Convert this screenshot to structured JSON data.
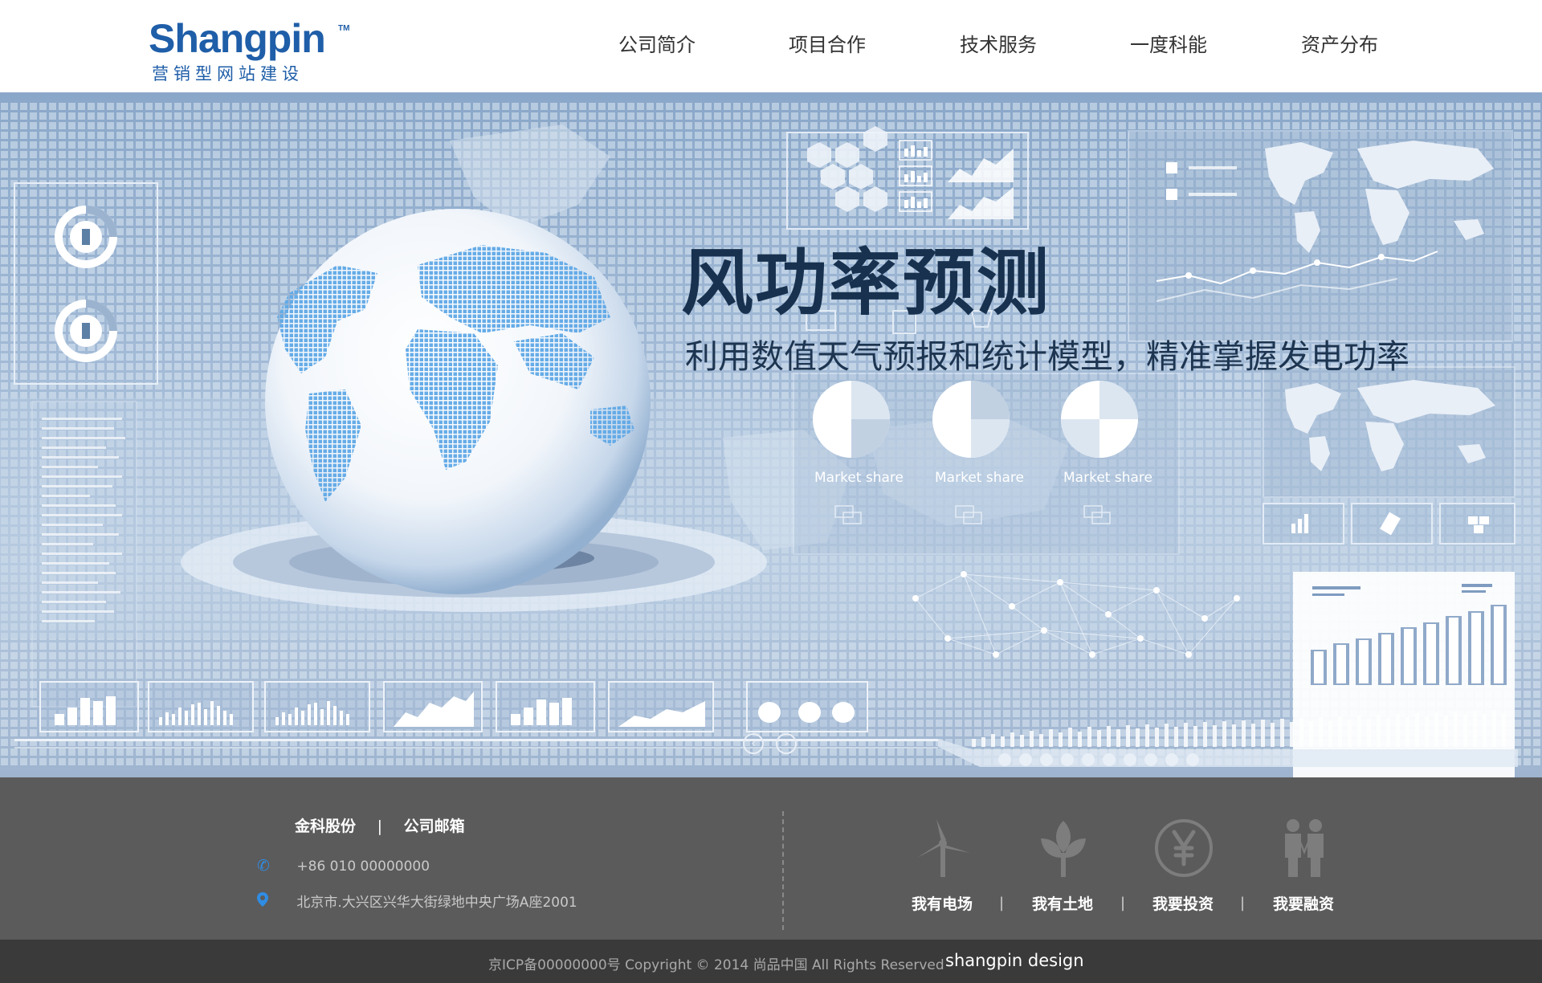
{
  "header": {
    "logo_text": "Shangpin",
    "logo_tm": "TM",
    "logo_sub": "营销型网站建设",
    "nav": [
      {
        "label": "公司简介"
      },
      {
        "label": "项目合作"
      },
      {
        "label": "技术服务"
      },
      {
        "label": "一度科能"
      },
      {
        "label": "资产分布"
      }
    ]
  },
  "banner": {
    "title": "风功率预测",
    "subtitle": "利用数值天气预报和统计模型，精准掌握发电功率",
    "market_share_labels": [
      "Market share",
      "Market share",
      "Market share"
    ],
    "slider": {
      "prev": "‹",
      "next": "›",
      "dot_count": 10
    }
  },
  "footer": {
    "links": [
      "金科股份",
      "公司邮箱"
    ],
    "link_separator": "|",
    "phone": "+86 010 00000000",
    "address": "北京市.大兴区兴华大街绿地中央广场A座2001",
    "services": [
      {
        "label": "我有电场",
        "icon": "wind-turbine-icon"
      },
      {
        "label": "我有土地",
        "icon": "leaf-icon"
      },
      {
        "label": "我要投资",
        "icon": "yen-icon"
      },
      {
        "label": "我要融资",
        "icon": "partners-icon"
      }
    ],
    "service_separator": "|",
    "copyright": "京ICP备00000000号 Copyright © 2014 尚品中国 All Rights Reserved",
    "brand": "shangpin design"
  },
  "colors": {
    "brand_blue": "#1f5ea8",
    "footer_bg": "#5b5b5c",
    "copyright_bg": "#3a3a3a",
    "banner_title": "#17314f"
  }
}
